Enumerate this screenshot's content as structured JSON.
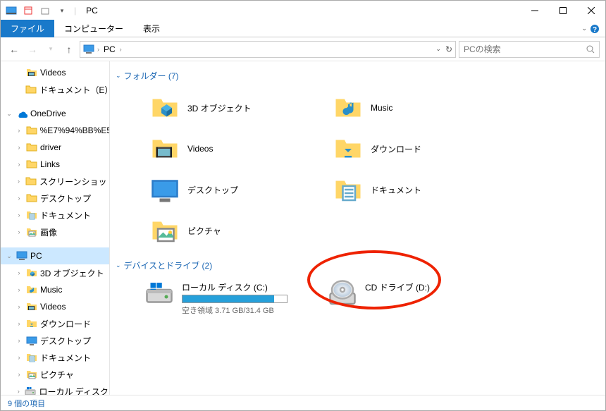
{
  "title": "PC",
  "ribbon": {
    "file": "ファイル",
    "computer": "コンピューター",
    "view": "表示"
  },
  "address": {
    "root": "PC",
    "search_placeholder": "PCの検索"
  },
  "sidebar": {
    "quick": [
      {
        "label": "Videos",
        "icon": "videos"
      },
      {
        "label": "ドキュメント（E）",
        "icon": "folder"
      }
    ],
    "onedrive": {
      "label": "OneDrive",
      "expanded": true
    },
    "onedrive_items": [
      {
        "label": "%E7%94%BB%E5",
        "icon": "folder"
      },
      {
        "label": "driver",
        "icon": "folder"
      },
      {
        "label": "Links",
        "icon": "folder"
      },
      {
        "label": "スクリーンショット",
        "icon": "folder"
      },
      {
        "label": "デスクトップ",
        "icon": "folder"
      },
      {
        "label": "ドキュメント",
        "icon": "documents"
      },
      {
        "label": "画像",
        "icon": "pictures"
      }
    ],
    "pc": {
      "label": "PC",
      "expanded": true,
      "selected": true
    },
    "pc_items": [
      {
        "label": "3D オブジェクト",
        "icon": "3d"
      },
      {
        "label": "Music",
        "icon": "music"
      },
      {
        "label": "Videos",
        "icon": "videos"
      },
      {
        "label": "ダウンロード",
        "icon": "downloads"
      },
      {
        "label": "デスクトップ",
        "icon": "desktop"
      },
      {
        "label": "ドキュメント",
        "icon": "documents"
      },
      {
        "label": "ピクチャ",
        "icon": "pictures"
      },
      {
        "label": "ローカル ディスク (C",
        "icon": "drive"
      }
    ]
  },
  "groups": {
    "folders": {
      "title": "フォルダー (7)",
      "items": [
        {
          "label": "3D オブジェクト",
          "icon": "3d"
        },
        {
          "label": "Music",
          "icon": "music"
        },
        {
          "label": "Videos",
          "icon": "videos"
        },
        {
          "label": "ダウンロード",
          "icon": "downloads"
        },
        {
          "label": "デスクトップ",
          "icon": "desktop",
          "cloud": true
        },
        {
          "label": "ドキュメント",
          "icon": "documents"
        },
        {
          "label": "ピクチャ",
          "icon": "pictures"
        }
      ]
    },
    "drives": {
      "title": "デバイスとドライブ (2)",
      "items": [
        {
          "label": "ローカル ディスク (C:)",
          "free": "空き領域 3.71 GB/31.4 GB",
          "fill_pct": 88,
          "icon": "hdd"
        },
        {
          "label": "CD ドライブ (D:)",
          "icon": "cd",
          "highlighted": true
        }
      ]
    }
  },
  "status": "9 個の項目"
}
